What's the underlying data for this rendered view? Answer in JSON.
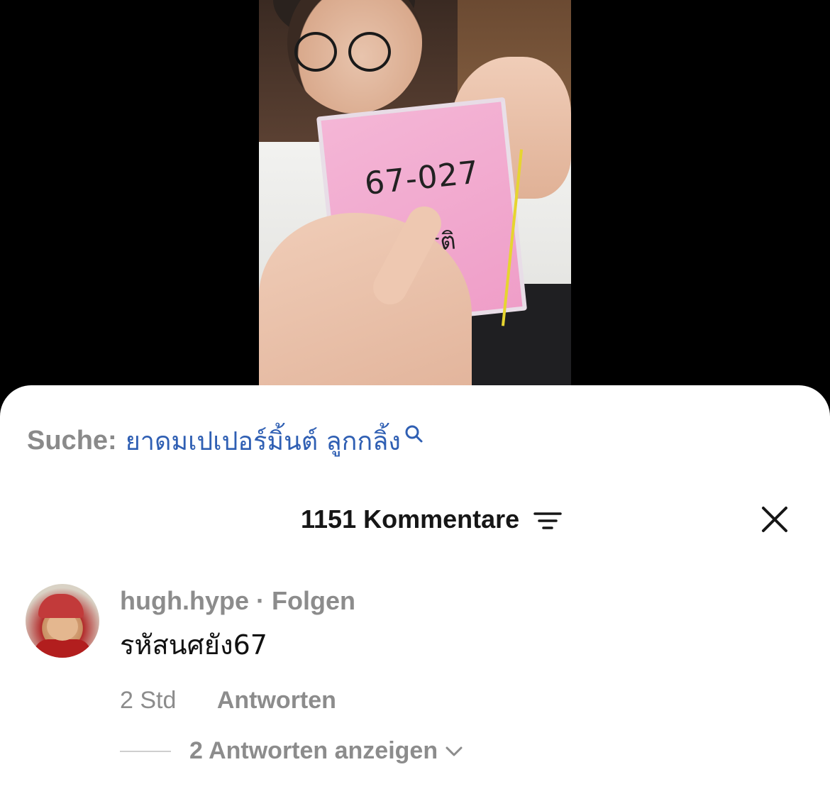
{
  "video": {
    "card_number": "67-027",
    "card_name": "ธรติ"
  },
  "search": {
    "label": "Suche:",
    "term": "ยาดมเปเปอร์มิ้นต์ ลูกกลิ้ง",
    "icon": "search-icon"
  },
  "comments_header": {
    "count_label": "1151 Kommentare",
    "sort_icon": "sort-icon",
    "close_icon": "close-icon"
  },
  "comment": {
    "username": "hugh.hype",
    "separator": "·",
    "follow_label": "Folgen",
    "text": "รหัสนศยัง67",
    "time": "2 Std",
    "reply_label": "Antworten",
    "view_replies_label": "2 Antworten anzeigen"
  },
  "colors": {
    "link_blue": "#2f5fb3",
    "muted_gray": "#8c8c8c",
    "text_dark": "#161616"
  }
}
